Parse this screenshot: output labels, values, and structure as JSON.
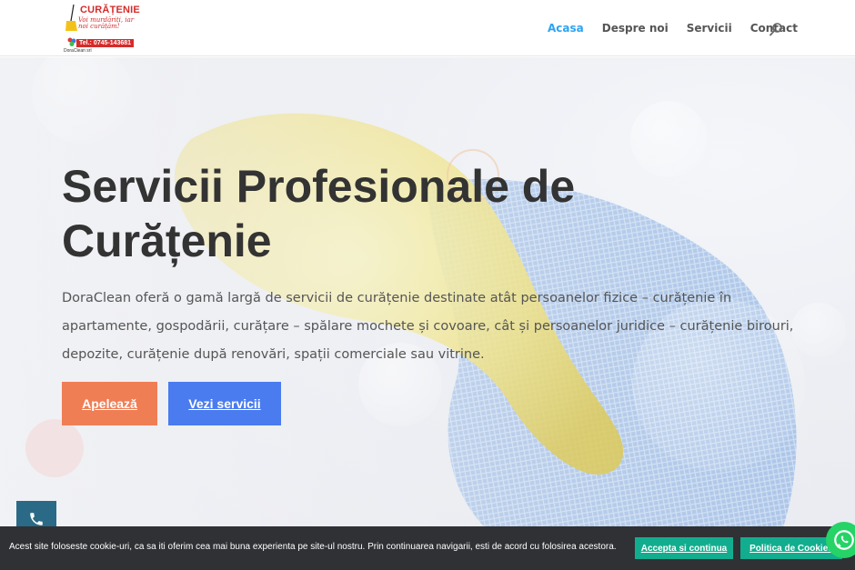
{
  "header": {
    "logo": {
      "brand": "CURĂȚENIE",
      "tagline": "Voi murdăriți, iar noi curățăm!",
      "phone": "Tel.: 0745-143681",
      "subtitle": "DoraClean srl"
    },
    "nav": [
      {
        "label": "Acasa",
        "active": true
      },
      {
        "label": "Despre noi",
        "active": false
      },
      {
        "label": "Servicii",
        "active": false
      },
      {
        "label": "Contact",
        "active": false
      }
    ],
    "search_icon": "search-icon"
  },
  "hero": {
    "title": "Servicii Profesionale de Curățenie",
    "text": "DoraClean oferă o gamă largă de servicii de curățenie destinate atât persoanelor fizice – curățenie în apartamente, gospodării, curățare – spălare mochete și covoare, cât și persoanelor juridice – curățenie birouri, depozite, curățenie după renovări, spații comerciale sau vitrine.",
    "buttons": {
      "call": "Apelează",
      "services": "Vezi servicii"
    }
  },
  "cookie_bar": {
    "text": "Acest site foloseste cookie-uri, ca sa iti oferim cea mai buna experienta pe site-ul nostru. Prin continuarea navigarii, esti de acord cu folosirea acestora.",
    "accept": "Accepta si continua",
    "policy": "Politica de Cookies"
  },
  "colors": {
    "accent_nav": "#2ea3f2",
    "call_button": "#f07e55",
    "services_button": "#4a7cf0",
    "cookie_button": "#12ad8e",
    "cookie_bar": "#2f3135",
    "phone_fab": "#2b6a86",
    "whatsapp": "#25d366"
  },
  "icons": {
    "phone_fab": "phone-icon",
    "whatsapp": "whatsapp-icon"
  }
}
